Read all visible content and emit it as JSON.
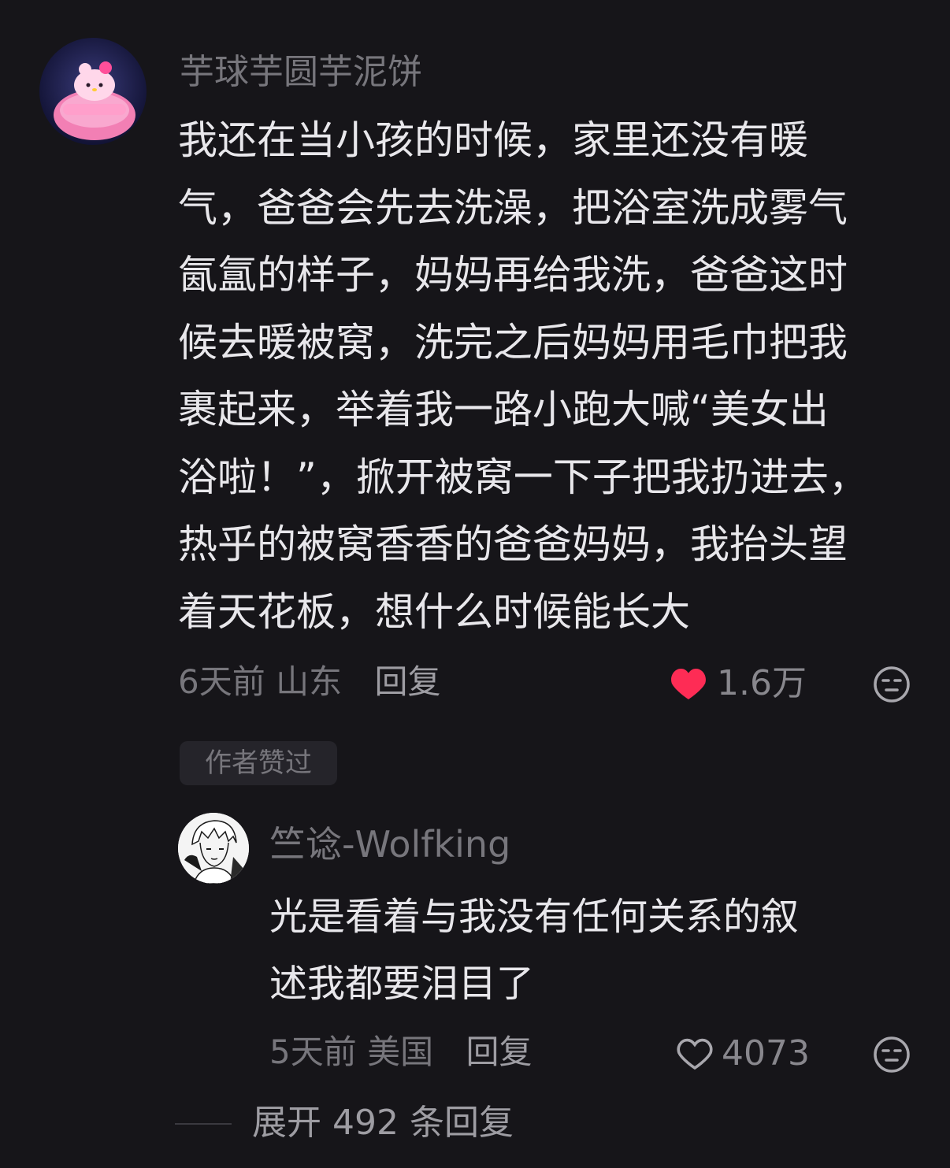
{
  "comment": {
    "username": "芋球芋圆芋泥饼",
    "lines": [
      "我还在当小孩的时候，家里还没有暖",
      "气，爸爸会先去洗澡，把浴室洗成雾气",
      "氤氲的样子，妈妈再给我洗，爸爸这时",
      "候去暖被窝，洗完之后妈妈用毛巾把我",
      "裹起来，举着我一路小跑大喊“美女出",
      "浴啦！”，掀开被窝一下子把我扔进去，",
      "热乎的被窝香香的爸爸妈妈，我抬头望",
      "着天花板，想什么时候能长大"
    ],
    "time": "6天前",
    "location": "山东",
    "reply_label": "回复",
    "likes": "1.6万",
    "liked": true,
    "badge": "作者赞过"
  },
  "reply": {
    "username": "竺谂-Wolfking",
    "lines": [
      "光是看着与我没有任何关系的叙",
      "述我都要泪目了"
    ],
    "time": "5天前",
    "location": "美国",
    "reply_label": "回复",
    "likes": "4073",
    "liked": false
  },
  "expand_label": "展开 492 条回复",
  "colors": {
    "background": "#161519",
    "text": "#e8e7eb",
    "muted": "#77767c",
    "heart": "#fe2c55"
  }
}
